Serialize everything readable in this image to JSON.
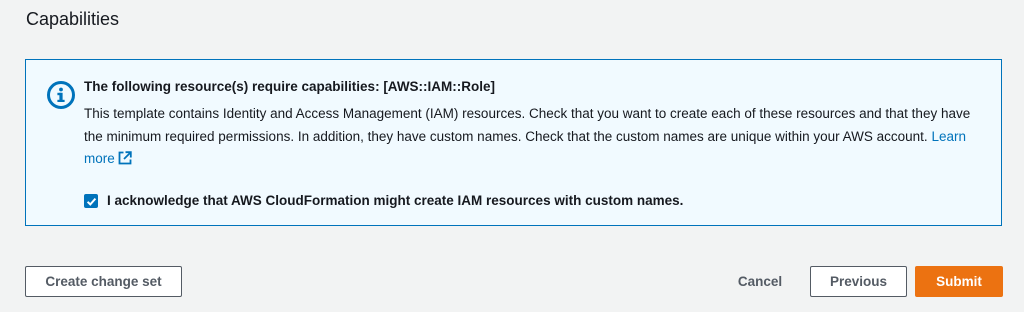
{
  "section": {
    "title": "Capabilities"
  },
  "alert": {
    "heading": "The following resource(s) require capabilities: [AWS::IAM::Role]",
    "body": "This template contains Identity and Access Management (IAM) resources. Check that you want to create each of these resources and that they have the minimum required permissions. In addition, they have custom names. Check that the custom names are unique within your AWS account.",
    "learn_more": "Learn more",
    "icon": "info-icon",
    "acknowledge": {
      "checked": true,
      "label": "I acknowledge that AWS CloudFormation might create IAM resources with custom names."
    }
  },
  "actions": {
    "create_change_set": "Create change set",
    "cancel": "Cancel",
    "previous": "Previous",
    "submit": "Submit"
  },
  "colors": {
    "accent_blue": "#0073bb",
    "alert_background": "#f1faff",
    "primary_orange": "#ec7211",
    "page_background": "#f2f3f3"
  }
}
